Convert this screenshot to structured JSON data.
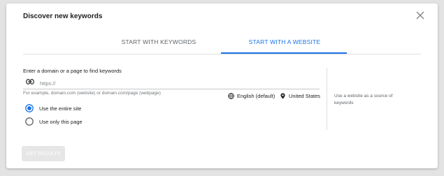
{
  "dialog": {
    "title": "Discover new keywords"
  },
  "tabs": [
    {
      "label": "START WITH KEYWORDS",
      "active": false
    },
    {
      "label": "START WITH A WEBSITE",
      "active": true
    }
  ],
  "form": {
    "label": "Enter a domain or a page to find keywords",
    "url_placeholder": "https://",
    "hint": "For example, domain.com (website) or domain.com/page (webpage)",
    "language": "English (default)",
    "location": "United States",
    "options": [
      {
        "label": "Use the entire site",
        "selected": true
      },
      {
        "label": "Use only this page",
        "selected": false
      }
    ]
  },
  "side_note": "Use a website as a source of keywords",
  "actions": {
    "get_results": "GET RESULTS",
    "get_results_enabled": false
  },
  "icons": {
    "close": "close-icon",
    "link": "link-icon",
    "globe": "globe-icon",
    "location": "location-pin-icon"
  },
  "colors": {
    "accent": "#1a73e8",
    "text": "#202124",
    "muted": "#5f6368"
  }
}
